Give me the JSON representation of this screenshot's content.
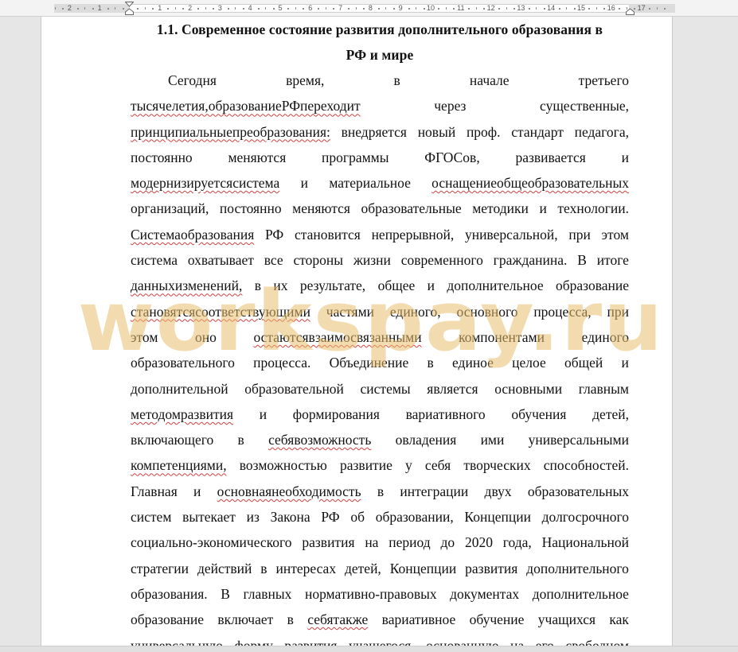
{
  "ruler": {
    "numbers": [
      "2",
      "1",
      "1",
      "2",
      "3",
      "4",
      "5",
      "6",
      "7",
      "8",
      "9",
      "10",
      "11",
      "12",
      "13",
      "14",
      "15",
      "16",
      "17"
    ]
  },
  "document": {
    "heading_line1": "1.1. Современное состояние развития дополнительного образования в",
    "heading_line2": "РФ и мире",
    "lines": [
      [
        "Сегодня",
        "время,",
        "в",
        "начале",
        "третьего"
      ],
      [
        "тысячелетия,образованиеРФпереходит",
        "через",
        "существенные,"
      ],
      [
        "принципиальныепреобразования: внедряется новый проф. стандарт педагога,"
      ],
      [
        "постоянно",
        "меняются",
        "программы",
        "ФГОСов,",
        "развивается",
        "и"
      ],
      [
        "модернизируетсясистема",
        "и",
        "материальное",
        "оснащениеобщеобразовательных"
      ],
      [
        "организаций, постоянно меняются образовательные методики и технологии."
      ],
      [
        "Системаобразования РФ становится непрерывной, универсальной, при этом"
      ],
      [
        "система охватывает все стороны жизни современного гражданина. В итоге"
      ],
      [
        "данныхизменений, в их результате, общее и дополнительное образование"
      ],
      [
        "становятсясоответствующими",
        "частями",
        "единого,",
        "основного",
        "процесса,",
        "при"
      ],
      [
        "этом",
        "оно",
        "остаютсявзаимосвязанными",
        "компонентами",
        "единого"
      ],
      [
        "образовательного",
        "процесса.",
        "Объединение",
        "в",
        "единое",
        "целое",
        "общей",
        "и"
      ],
      [
        "дополнительной образовательной системы является основными главным"
      ],
      [
        "методомразвития",
        "и",
        "формирования",
        "вариативного",
        "обучения",
        "детей,"
      ],
      [
        "включающего",
        "в",
        "себявозможность",
        "овладения",
        "ими",
        "универсальными"
      ],
      [
        "компетенциями, возможностью развитие у себя творческих способностей."
      ],
      [
        "Главная",
        "и",
        "основнаянеобходимость",
        "в",
        "интеграции",
        "двух",
        "образовательных"
      ],
      [
        "систем вытекает из Закона РФ об образовании, Концепции долгосрочного"
      ],
      [
        "социально-экономического развития на период до 2020 года, Национальной"
      ],
      [
        "стратегии действий в интересах детей, Концепции развития дополнительного"
      ],
      [
        "образования. В главных нормативно-правовых документах дополнительное"
      ],
      [
        "образование включает в себятакже вариативное обучение учащихся как"
      ],
      [
        "универсальную форму развития учащегося, основанную на его свободном"
      ]
    ]
  },
  "watermark": {
    "text": "workspay.ru"
  },
  "colors": {
    "watermark": "#e8be6e",
    "spellcheck": "#d24040"
  }
}
